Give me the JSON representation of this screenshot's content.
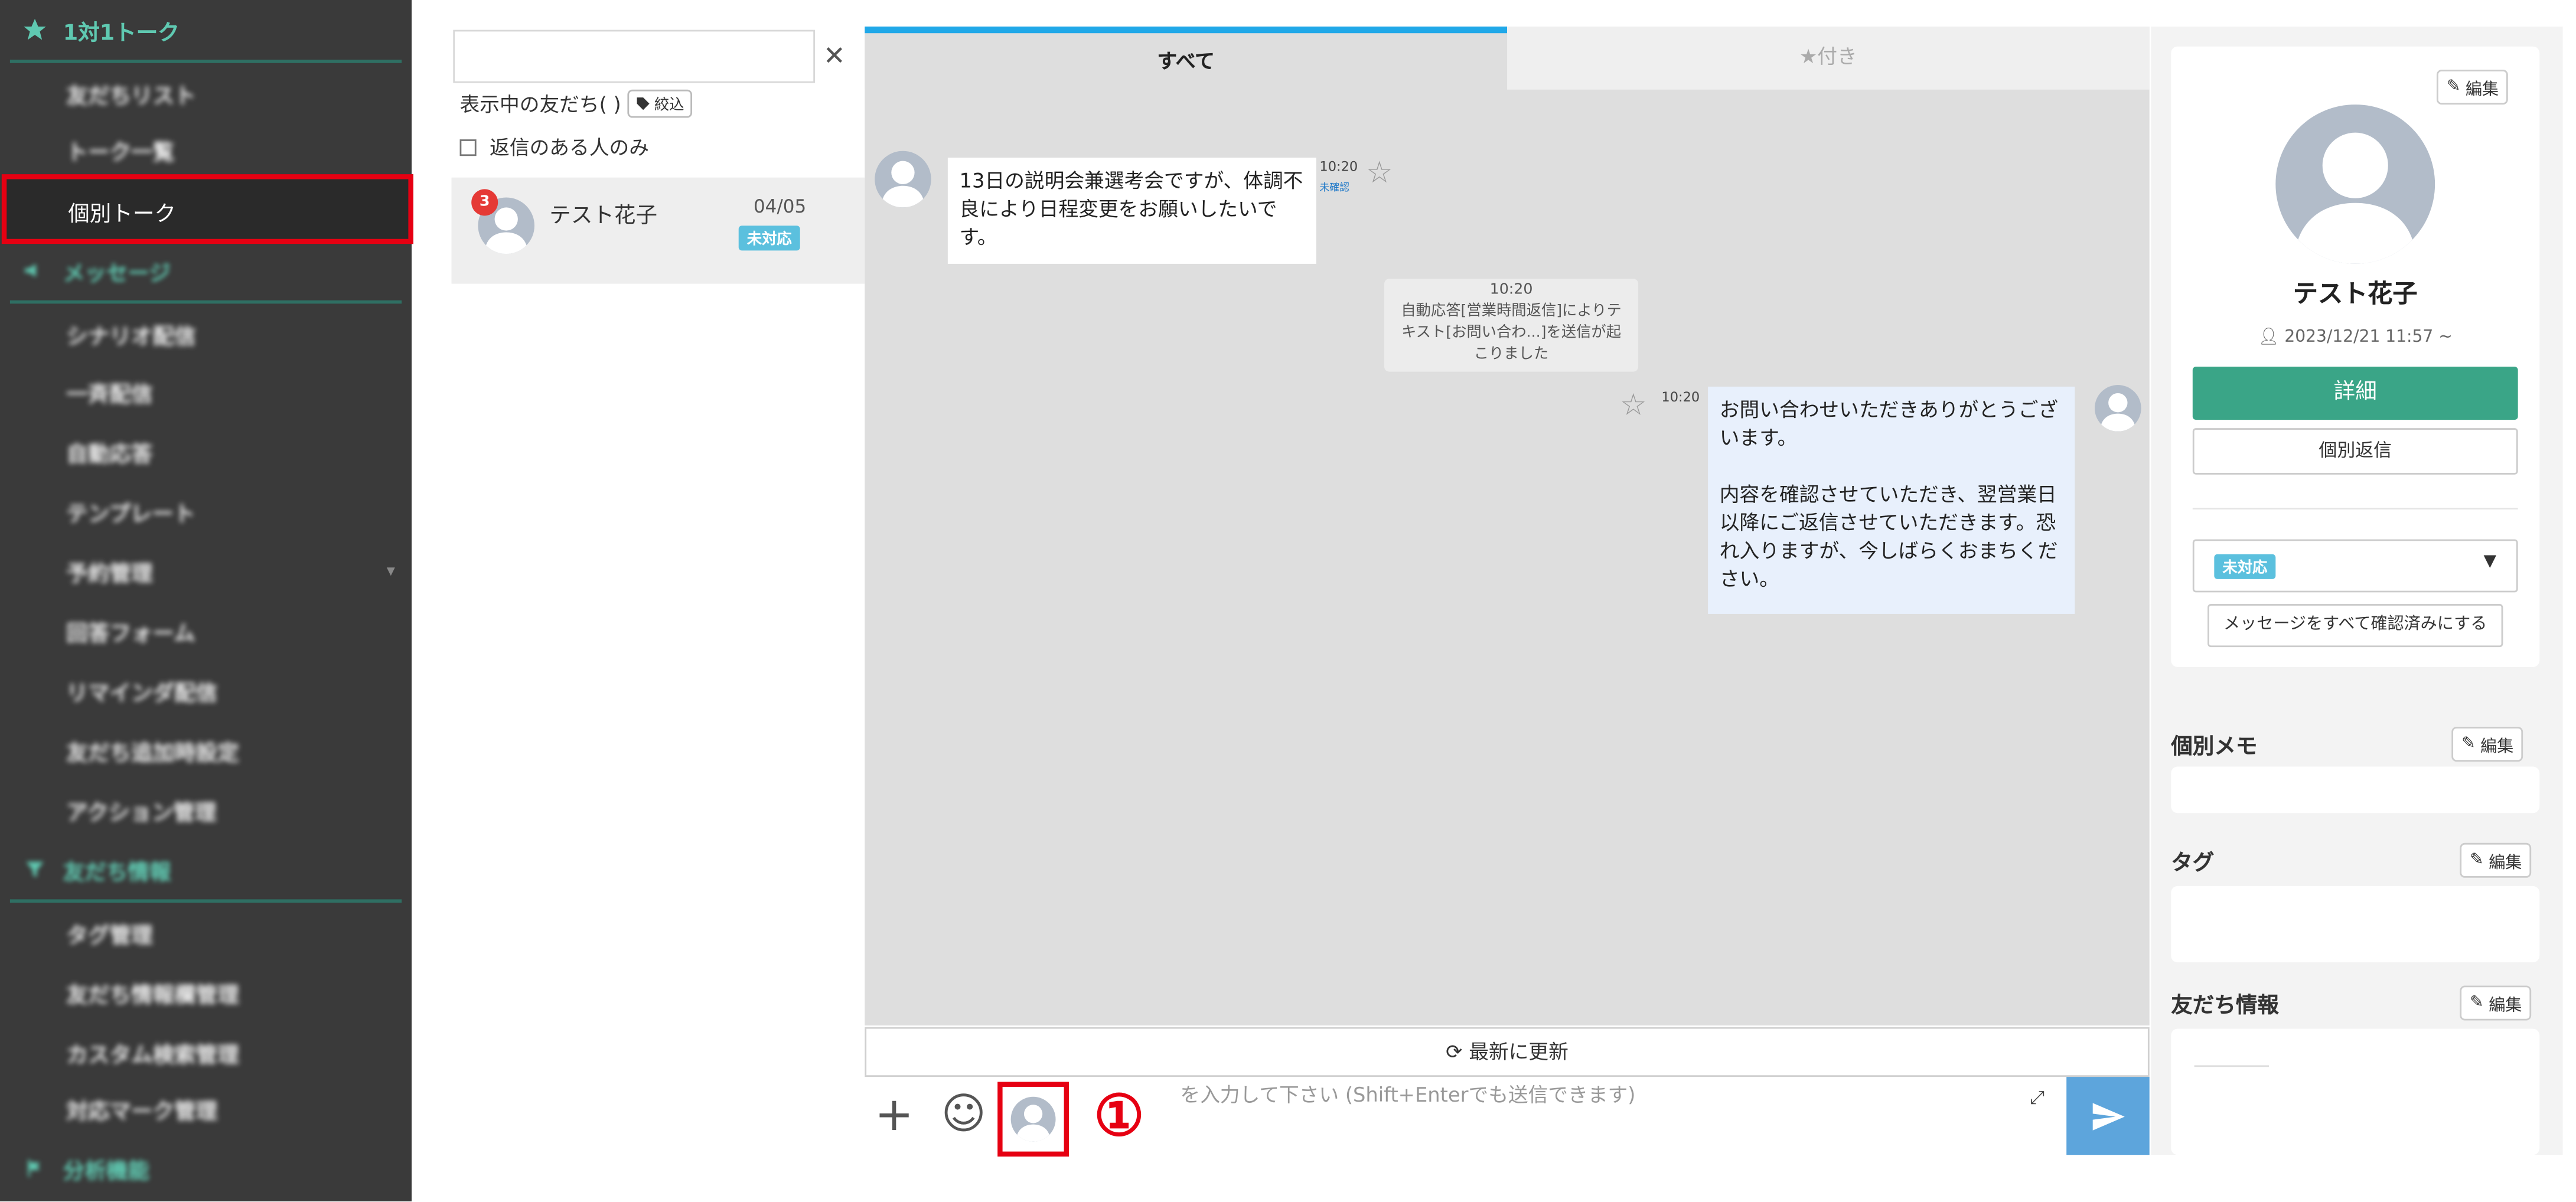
{
  "sidebar": {
    "section1": "1対1トーク",
    "items1": [
      "友だちリスト",
      "トーク一覧"
    ],
    "active_item": "個別トーク",
    "section2": "メッセージ",
    "items2": [
      "シナリオ配信",
      "一斉配信",
      "自動応答",
      "テンプレート",
      "予約管理",
      "回答フォーム",
      "リマインダ配信",
      "友だち追加時設定",
      "アクション管理"
    ],
    "section3": "友だち情報",
    "items3": [
      "タグ管理",
      "友だち情報欄管理",
      "カスタム検索管理",
      "対応マーク管理"
    ],
    "section4": "分析機能"
  },
  "friends_panel": {
    "search_value": "",
    "count_label": "表示中の友だち( )",
    "filter_label": "絞込",
    "reply_only_label": "返信のある人のみ",
    "friend": {
      "name": "テスト花子",
      "date": "04/05",
      "badge": "3",
      "status": "未対応"
    }
  },
  "chat": {
    "tabs": [
      "すべて",
      "★付き"
    ],
    "incoming": {
      "text": "13日の説明会兼選考会ですが、体調不良により日程変更をお願いしたいです。",
      "time": "10:20",
      "read_status": "未確認"
    },
    "system": {
      "time": "10:20",
      "text": "自動応答[営業時間返信]によりテキスト[お問い合わ...]を送信が起こりました"
    },
    "outgoing": {
      "time": "10:20",
      "text1": "お問い合わせいただきありがとうございます。",
      "text2": "内容を確認させていただき、翌営業日以降にご返信させていただきます。恐れ入りますが、今しばらくおまちください。"
    },
    "refresh_label": "最新に更新",
    "composer_placeholder": "を入力して下さい (Shift+Enterでも送信できます)",
    "annotation": "①"
  },
  "profile": {
    "edit_label": "編集",
    "name": "テスト花子",
    "date": "2023/12/21 11:57 ~",
    "detail_button": "詳細",
    "reply_button": "個別返信",
    "status": "未対応",
    "mark_all_read": "メッセージをすべて確認済みにする",
    "memo_label": "個別メモ",
    "tag_label": "タグ",
    "friend_info_label": "友だち情報"
  },
  "colors": {
    "accent_teal": "#5fc9b1",
    "highlight_red": "#e60012",
    "tab_blue": "#20a8e8",
    "detail_green": "#3aa587",
    "status_blue": "#5bc0de"
  }
}
